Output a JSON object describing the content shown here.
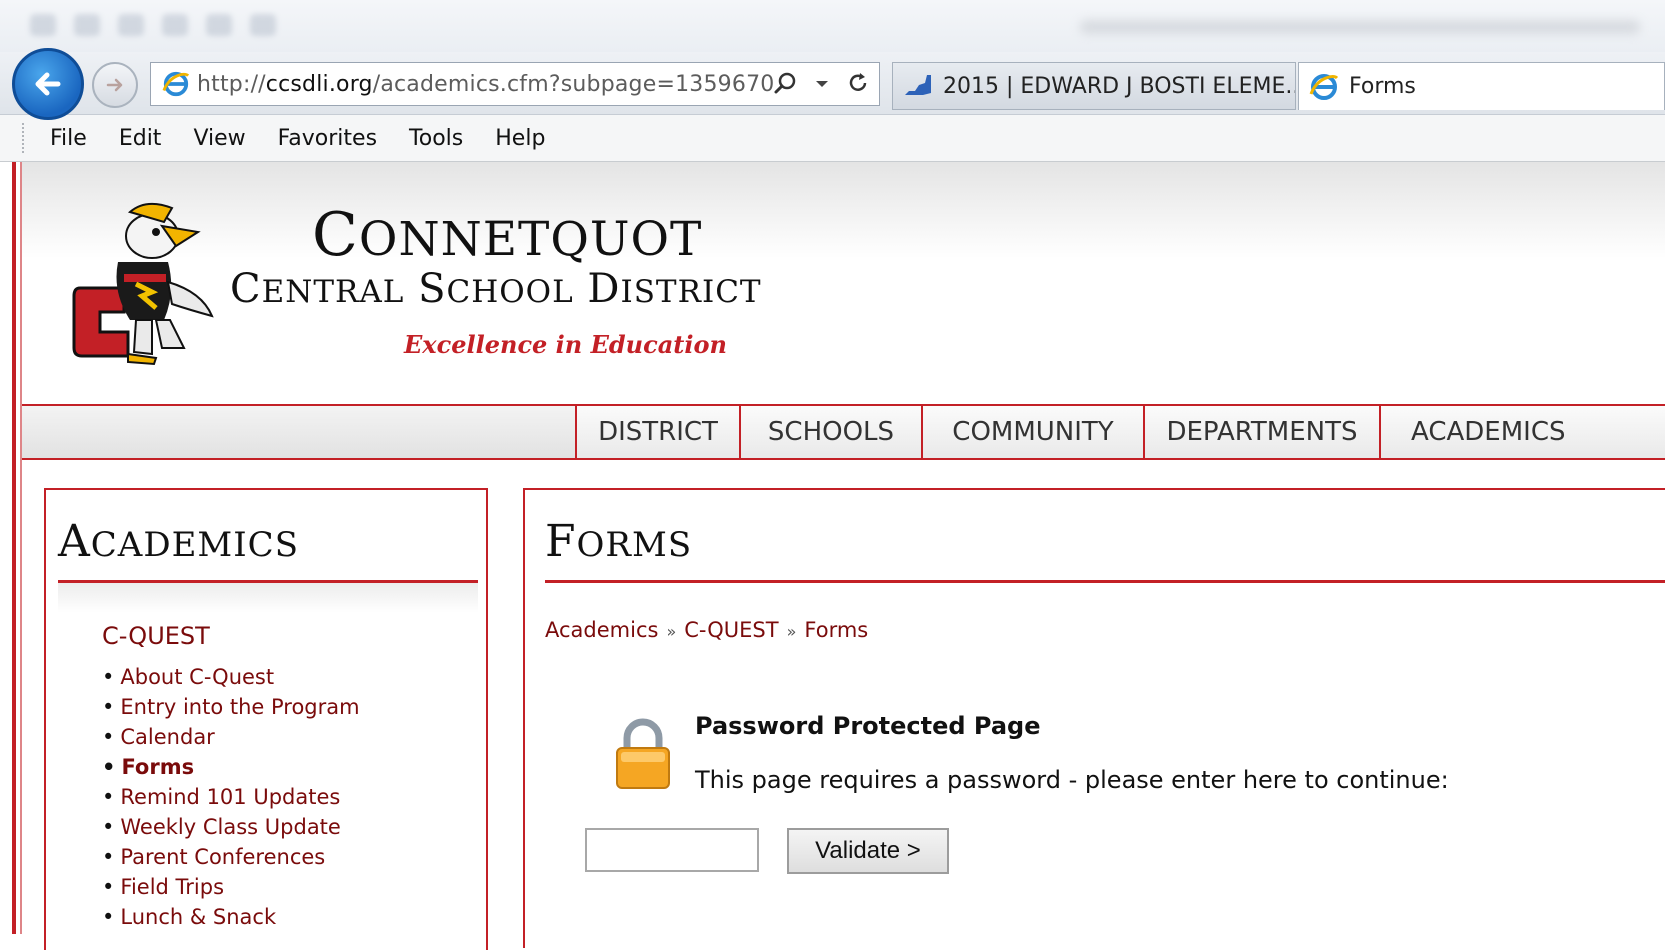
{
  "browser": {
    "address": {
      "scheme": "http://",
      "domain": "ccsdli.org",
      "path": "/academics.cfm?subpage=1359670"
    },
    "tabs": [
      {
        "label": "2015 | EDWARD J BOSTI ELEME...",
        "icon": "ny-state-icon"
      },
      {
        "label": "Forms",
        "icon": "ie-icon"
      }
    ],
    "menu": [
      "File",
      "Edit",
      "View",
      "Favorites",
      "Tools",
      "Help"
    ]
  },
  "site": {
    "title_main": "Connetquot",
    "title_main_first": "C",
    "title_main_rest": "ONNETQUOT",
    "subtitle_parts": {
      "w1_first": "C",
      "w1_rest": "ENTRAL",
      "w2_first": "S",
      "w2_rest": "CHOOL",
      "w3_first": "D",
      "w3_rest": "ISTRICT"
    },
    "tagline": "Excellence in Education",
    "nav": [
      "DISTRICT",
      "SCHOOLS",
      "COMMUNITY",
      "DEPARTMENTS",
      "ACADEMICS"
    ],
    "accent_color": "#c32026"
  },
  "sidebar": {
    "title_first": "A",
    "title_rest": "CADEMICS",
    "group": "C-QUEST",
    "items": [
      "About C-Quest",
      "Entry into the Program",
      "Calendar",
      "Forms",
      "Remind 101 Updates",
      "Weekly Class Update",
      "Parent Conferences",
      "Field Trips",
      "Lunch & Snack"
    ],
    "active_item": "Forms"
  },
  "main": {
    "title_first": "F",
    "title_rest": "ORMS",
    "breadcrumb": [
      "Academics",
      "C-QUEST",
      "Forms"
    ],
    "protected_title": "Password Protected Page",
    "protected_text": "This page requires a password - please enter here to continue:",
    "password_value": "",
    "validate_label": "Validate >"
  }
}
